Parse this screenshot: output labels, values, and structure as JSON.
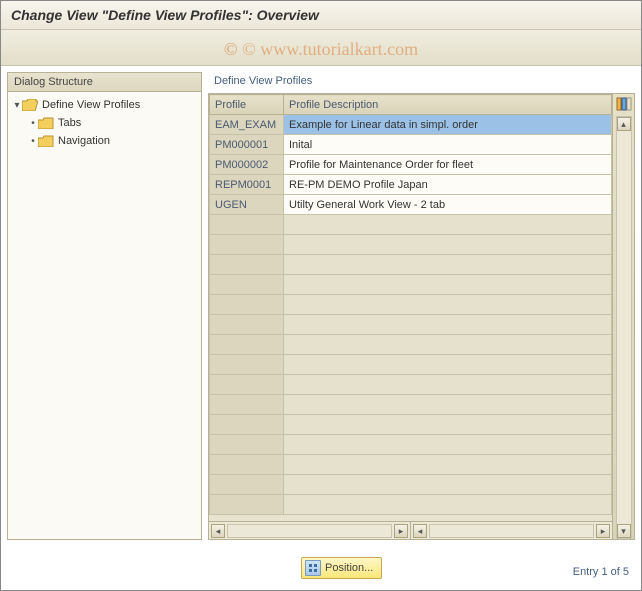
{
  "title": "Change View \"Define View Profiles\": Overview",
  "watermark": "© www.tutorialkart.com",
  "sidebar": {
    "header": "Dialog Structure",
    "root": {
      "label": "Define View Profiles"
    },
    "children": [
      {
        "label": "Tabs"
      },
      {
        "label": "Navigation"
      }
    ]
  },
  "panel": {
    "title": "Define View Profiles",
    "columns": {
      "profile": "Profile",
      "description": "Profile Description"
    },
    "rows": [
      {
        "profile": "EAM_EXAM",
        "description": "Example for Linear data in simpl. order",
        "selected": true
      },
      {
        "profile": "PM000001",
        "description": "Inital"
      },
      {
        "profile": "PM000002",
        "description": "Profile for Maintenance Order for fleet"
      },
      {
        "profile": "REPM0001",
        "description": "RE-PM DEMO Profile Japan"
      },
      {
        "profile": "UGEN",
        "description": "Utilty General Work View - 2 tab"
      }
    ],
    "empty_rows": 15
  },
  "footer": {
    "position_label": "Position...",
    "entry_text": "Entry 1 of 5"
  }
}
